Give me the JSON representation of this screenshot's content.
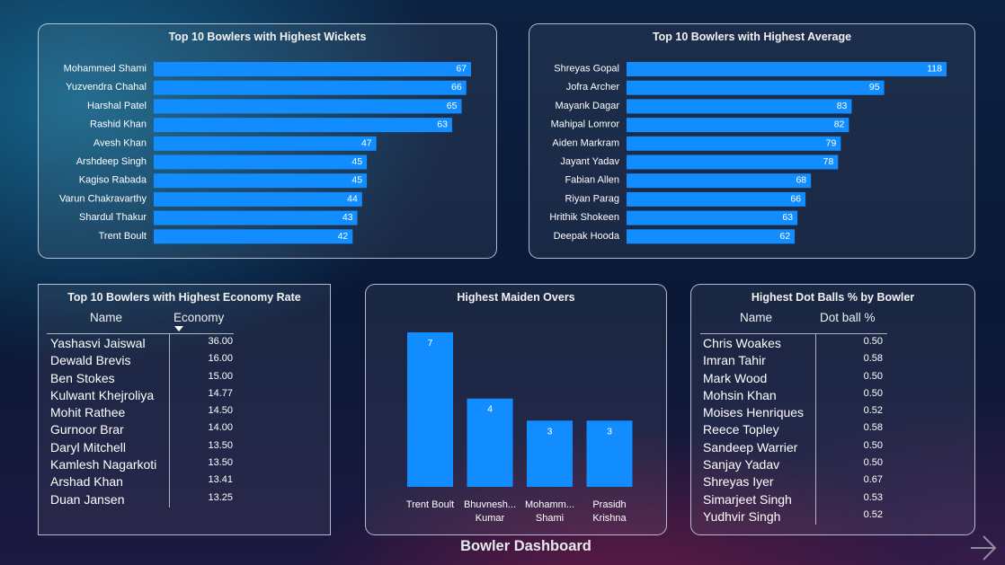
{
  "dashboard": {
    "title": "Bowler Dashboard",
    "next_icon": "arrow-right-icon"
  },
  "colors": {
    "bar": "#118dff",
    "text": "#ffffff",
    "border": "#d7e1f0"
  },
  "wickets": {
    "title": "Top 10 Bowlers with Highest Wickets",
    "chart_data": {
      "type": "bar",
      "orientation": "horizontal",
      "categories": [
        "Mohammed Shami",
        "Yuzvendra Chahal",
        "Harshal Patel",
        "Rashid Khan",
        "Avesh Khan",
        "Arshdeep Singh",
        "Kagiso Rabada",
        "Varun Chakravarthy",
        "Shardul Thakur",
        "Trent Boult"
      ],
      "values": [
        67,
        66,
        65,
        63,
        47,
        45,
        45,
        44,
        43,
        42
      ],
      "xlim": [
        0,
        67
      ],
      "data_labels": true
    }
  },
  "average": {
    "title": "Top 10 Bowlers with Highest Average",
    "chart_data": {
      "type": "bar",
      "orientation": "horizontal",
      "categories": [
        "Shreyas Gopal",
        "Jofra Archer",
        "Mayank Dagar",
        "Mahipal Lomror",
        "Aiden Markram",
        "Jayant Yadav",
        "Fabian Allen",
        "Riyan Parag",
        "Hrithik Shokeen",
        "Deepak Hooda"
      ],
      "values": [
        118,
        95,
        83,
        82,
        79,
        78,
        68,
        66,
        63,
        62
      ],
      "xlim": [
        0,
        118
      ],
      "data_labels": true
    }
  },
  "economy": {
    "title": "Top 10 Bowlers with Highest Economy Rate",
    "columns": [
      "Name",
      "Economy"
    ],
    "sort_icon": "sort-descending-icon",
    "rows": [
      {
        "name": "Yashasvi Jaiswal",
        "value": "36.00"
      },
      {
        "name": "Dewald Brevis",
        "value": "16.00"
      },
      {
        "name": "Ben Stokes",
        "value": "15.00"
      },
      {
        "name": "Kulwant Khejroliya",
        "value": "14.77"
      },
      {
        "name": "Mohit Rathee",
        "value": "14.50"
      },
      {
        "name": "Gurnoor Brar",
        "value": "14.00"
      },
      {
        "name": "Daryl Mitchell",
        "value": "13.50"
      },
      {
        "name": "Kamlesh Nagarkoti",
        "value": "13.50"
      },
      {
        "name": "Arshad Khan",
        "value": "13.41"
      },
      {
        "name": "Duan Jansen",
        "value": "13.25"
      }
    ]
  },
  "maidens": {
    "title": "Highest Maiden Overs",
    "chart_data": {
      "type": "bar",
      "orientation": "vertical",
      "categories": [
        [
          "Trent Boult"
        ],
        [
          "Bhuvnesh...",
          "Kumar"
        ],
        [
          "Mohamm...",
          "Shami"
        ],
        [
          "Prasidh",
          "Krishna"
        ]
      ],
      "values": [
        7,
        4,
        3,
        3
      ],
      "ylim": [
        0,
        7
      ],
      "data_labels": true
    }
  },
  "dotballs": {
    "title": "Highest Dot Balls % by Bowler",
    "columns": [
      "Name",
      "Dot ball %"
    ],
    "rows": [
      {
        "name": "Chris Woakes",
        "value": "0.50"
      },
      {
        "name": "Imran Tahir",
        "value": "0.58"
      },
      {
        "name": "Mark Wood",
        "value": "0.50"
      },
      {
        "name": "Mohsin Khan",
        "value": "0.50"
      },
      {
        "name": "Moises Henriques",
        "value": "0.52"
      },
      {
        "name": "Reece Topley",
        "value": "0.58"
      },
      {
        "name": "Sandeep Warrier",
        "value": "0.50"
      },
      {
        "name": "Sanjay Yadav",
        "value": "0.50"
      },
      {
        "name": "Shreyas Iyer",
        "value": "0.67"
      },
      {
        "name": "Simarjeet Singh",
        "value": "0.53"
      },
      {
        "name": "Yudhvir Singh",
        "value": "0.52"
      }
    ]
  }
}
